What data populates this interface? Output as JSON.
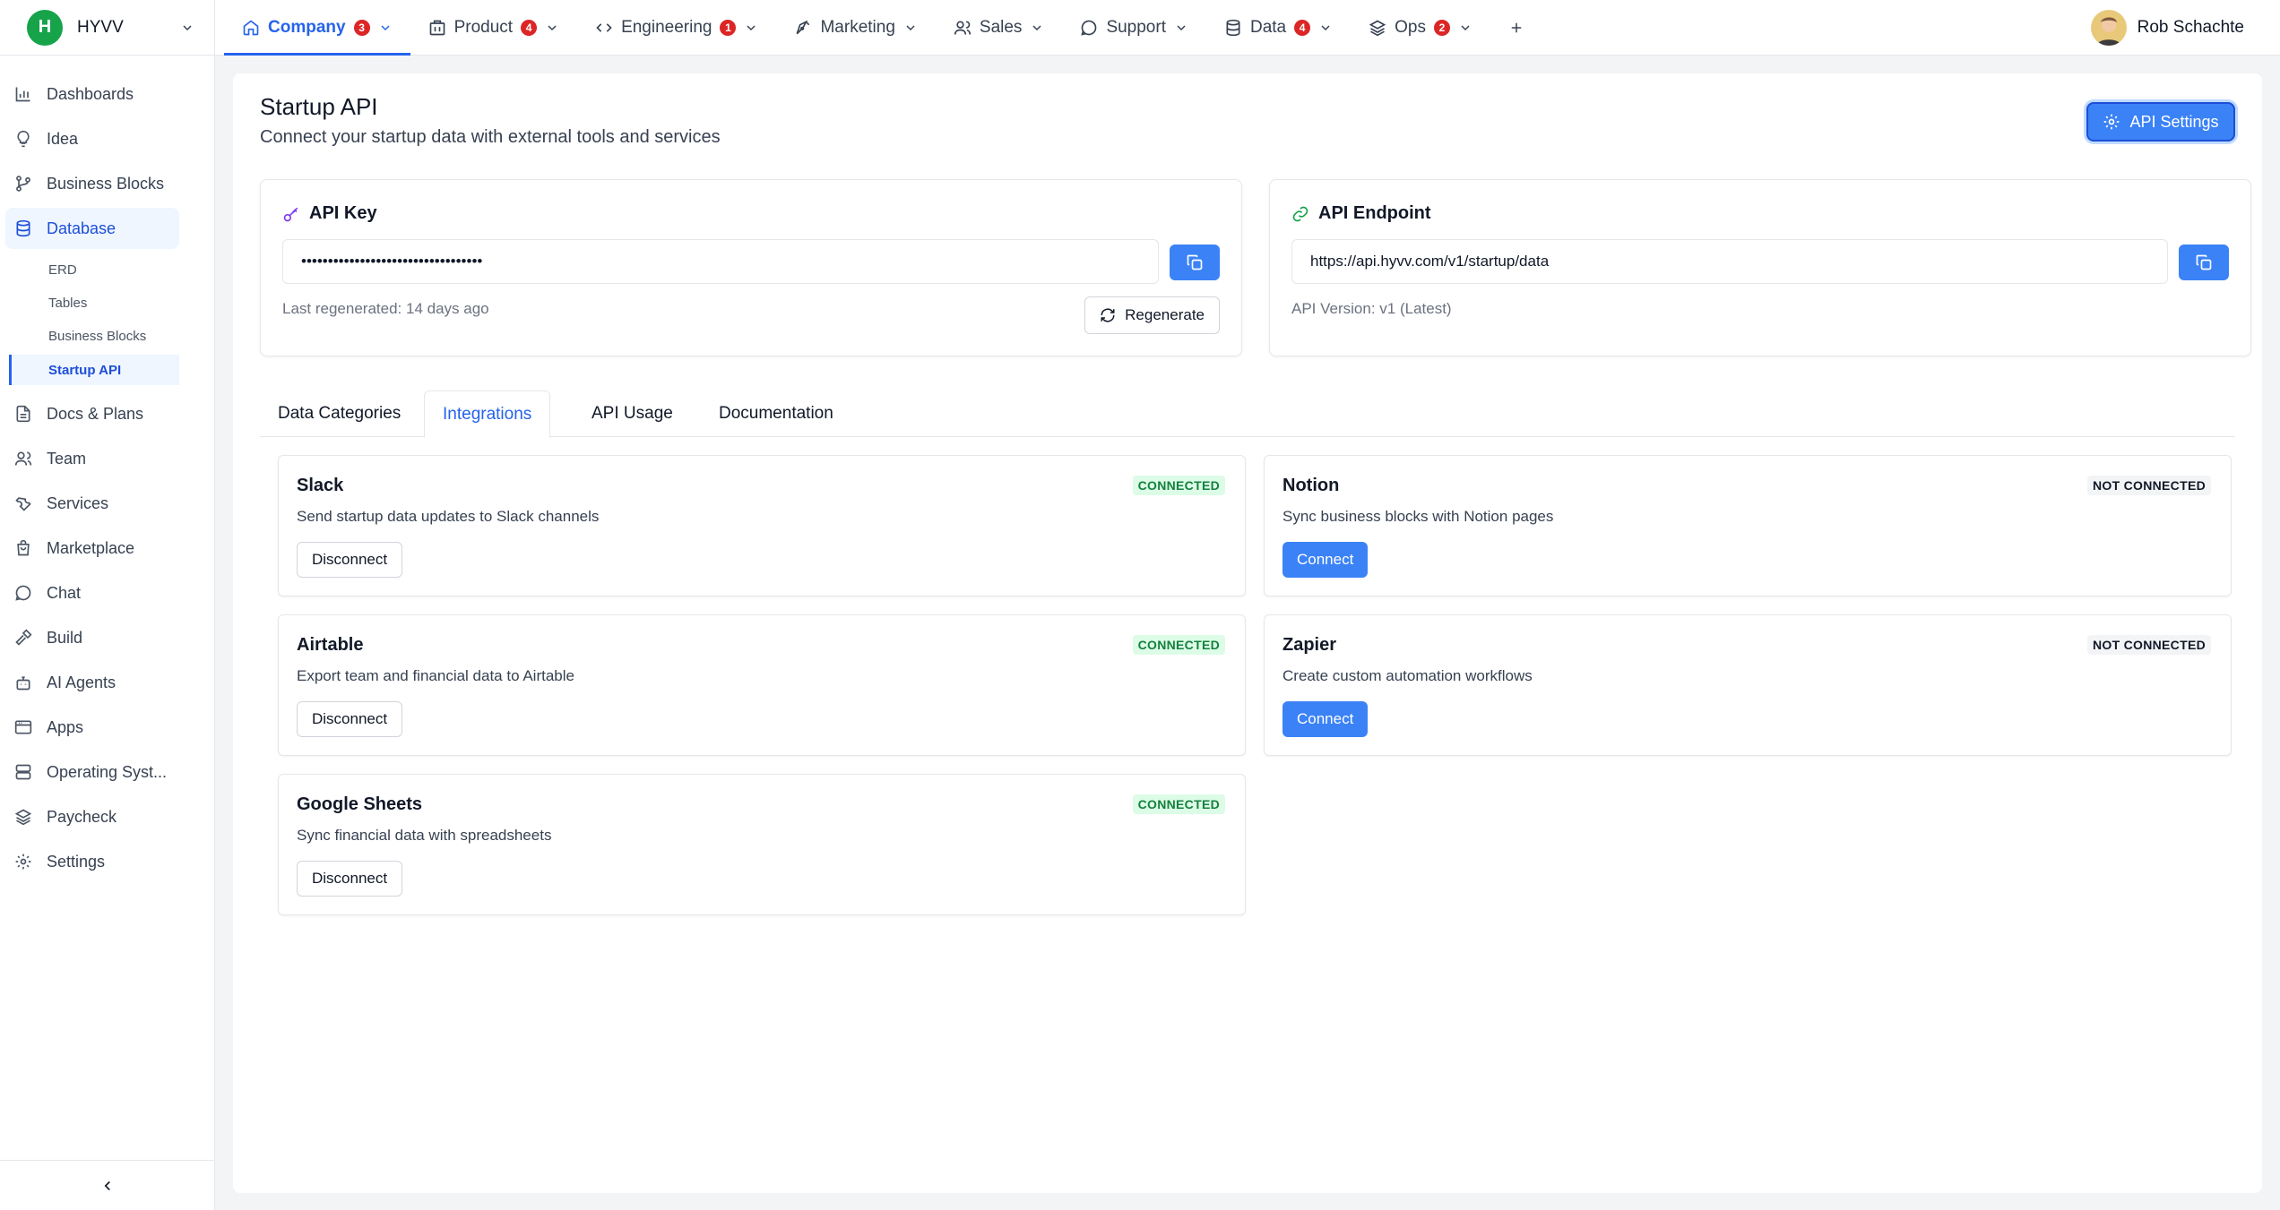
{
  "org": {
    "initial": "H",
    "name": "HYVV"
  },
  "nav": {
    "tabs": [
      {
        "label": "Company",
        "badge": "3"
      },
      {
        "label": "Product",
        "badge": "4"
      },
      {
        "label": "Engineering",
        "badge": "1"
      },
      {
        "label": "Marketing",
        "badge": ""
      },
      {
        "label": "Sales",
        "badge": ""
      },
      {
        "label": "Support",
        "badge": ""
      },
      {
        "label": "Data",
        "badge": "4"
      },
      {
        "label": "Ops",
        "badge": "2"
      }
    ]
  },
  "user": {
    "name": "Rob Schachte"
  },
  "sidebar": {
    "items": [
      {
        "label": "Dashboards",
        "icon": "bar-chart-icon"
      },
      {
        "label": "Idea",
        "icon": "lightbulb-icon"
      },
      {
        "label": "Business Blocks",
        "icon": "git-branch-icon"
      },
      {
        "label": "Database",
        "icon": "database-icon"
      },
      {
        "label": "Docs & Plans",
        "icon": "file-text-icon"
      },
      {
        "label": "Team",
        "icon": "users-icon"
      },
      {
        "label": "Services",
        "icon": "wrench-icon"
      },
      {
        "label": "Marketplace",
        "icon": "shopping-bag-icon"
      },
      {
        "label": "Chat",
        "icon": "message-circle-icon"
      },
      {
        "label": "Build",
        "icon": "hammer-icon"
      },
      {
        "label": "AI Agents",
        "icon": "bot-icon"
      },
      {
        "label": "Apps",
        "icon": "app-window-icon"
      },
      {
        "label": "Operating Syst...",
        "icon": "server-icon"
      },
      {
        "label": "Paycheck",
        "icon": "layers-icon"
      },
      {
        "label": "Settings",
        "icon": "gear-icon"
      }
    ],
    "subitems": [
      {
        "label": "ERD"
      },
      {
        "label": "Tables"
      },
      {
        "label": "Business Blocks"
      },
      {
        "label": "Startup API"
      }
    ]
  },
  "page": {
    "title": "Startup API",
    "subtitle": "Connect your startup data with external tools and services",
    "settings_label": "API Settings"
  },
  "api_key": {
    "title": "API Key",
    "value": "••••••••••••••••••••••••••••••••••",
    "last_regenerated": "Last regenerated: 14 days ago",
    "regenerate_label": "Regenerate"
  },
  "api_endpoint": {
    "title": "API Endpoint",
    "url": "https://api.hyvv.com/v1/startup/data",
    "version": "API Version: v1 (Latest)"
  },
  "content_tabs": [
    {
      "label": "Data Categories"
    },
    {
      "label": "Integrations"
    },
    {
      "label": "API Usage"
    },
    {
      "label": "Documentation"
    }
  ],
  "integrations": [
    {
      "name": "Slack",
      "description": "Send startup data updates to Slack channels",
      "status": "CONNECTED",
      "action": "Disconnect"
    },
    {
      "name": "Notion",
      "description": "Sync business blocks with Notion pages",
      "status": "NOT CONNECTED",
      "action": "Connect"
    },
    {
      "name": "Airtable",
      "description": "Export team and financial data to Airtable",
      "status": "CONNECTED",
      "action": "Disconnect"
    },
    {
      "name": "Zapier",
      "description": "Create custom automation workflows",
      "status": "NOT CONNECTED",
      "action": "Connect"
    },
    {
      "name": "Google Sheets",
      "description": "Sync financial data with spreadsheets",
      "status": "CONNECTED",
      "action": "Disconnect"
    }
  ],
  "colors": {
    "accent": "#3b82f6",
    "connected_bg": "#dcfce7",
    "connected_text": "#15803d",
    "badge": "#dc2626"
  }
}
